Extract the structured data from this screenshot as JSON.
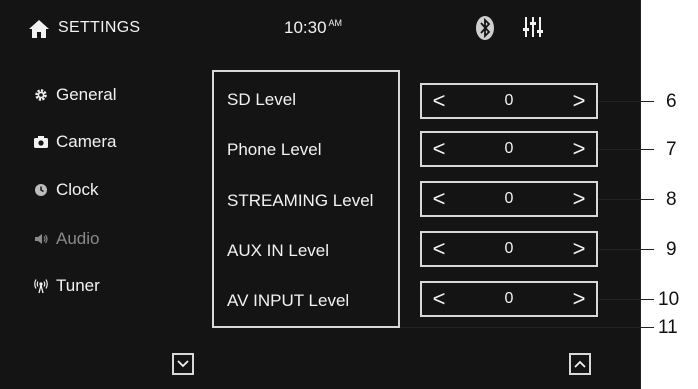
{
  "header": {
    "title": "SETTINGS",
    "time": "10:30",
    "ampm": "AM",
    "icons": [
      "home-icon",
      "bluetooth-icon",
      "equalizer-icon"
    ]
  },
  "sidebar": {
    "items": [
      {
        "label": "General",
        "icon": "gear-icon"
      },
      {
        "label": "Camera",
        "icon": "camera-icon"
      },
      {
        "label": "Clock",
        "icon": "clock-icon"
      },
      {
        "label": "Audio",
        "icon": "speaker-icon"
      },
      {
        "label": "Tuner",
        "icon": "antenna-icon"
      }
    ]
  },
  "levels": [
    {
      "label": "SD Level",
      "value": "0"
    },
    {
      "label": "Phone Level",
      "value": "0"
    },
    {
      "label": "STREAMING Level",
      "value": "0"
    },
    {
      "label": "AUX IN Level",
      "value": "0"
    },
    {
      "label": "AV INPUT Level",
      "value": "0"
    }
  ],
  "stepper_symbols": {
    "decrease": "<",
    "increase": ">"
  },
  "callouts": [
    "6",
    "7",
    "8",
    "9",
    "10",
    "11"
  ],
  "colors": {
    "screen_bg": "#141414",
    "text": "#f2f2f2",
    "border": "#d8d8d8",
    "dim_text": "#8a8a8a"
  }
}
